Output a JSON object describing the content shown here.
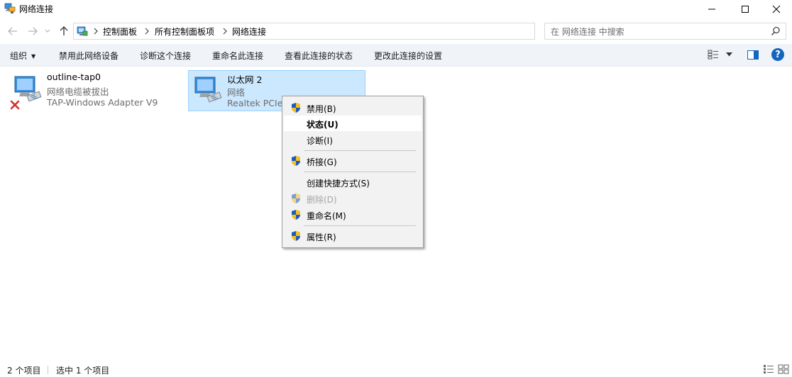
{
  "window": {
    "title": "网络连接",
    "controls": [
      "minimize-icon",
      "maximize-icon",
      "close-icon"
    ]
  },
  "address_bar": {
    "breadcrumbs": [
      "控制面板",
      "所有控制面板项",
      "网络连接"
    ],
    "search_placeholder": "在 网络连接 中搜索"
  },
  "toolbar": {
    "organize_label": "组织",
    "commands": [
      "禁用此网络设备",
      "诊断这个连接",
      "重命名此连接",
      "查看此连接的状态",
      "更改此连接的设置"
    ],
    "help_label": "?"
  },
  "items": [
    {
      "name": "outline-tap0",
      "status": "网络电缆被拔出",
      "device": "TAP-Windows Adapter V9",
      "selected": false,
      "disconnected": true
    },
    {
      "name": "以太网 2",
      "status": "网络",
      "device": "Realtek PCIe",
      "selected": true,
      "disconnected": false
    }
  ],
  "context_menu": {
    "items": [
      {
        "label": "禁用(B)",
        "shield": true,
        "bold": false,
        "disabled": false,
        "highlighted": false
      },
      {
        "label": "状态(U)",
        "shield": false,
        "bold": true,
        "disabled": false,
        "highlighted": true
      },
      {
        "label": "诊断(I)",
        "shield": false,
        "bold": false,
        "disabled": false,
        "highlighted": false
      },
      {
        "label": "桥接(G)",
        "shield": true,
        "bold": false,
        "disabled": false,
        "highlighted": false
      },
      {
        "label": "创建快捷方式(S)",
        "shield": false,
        "bold": false,
        "disabled": false,
        "highlighted": false
      },
      {
        "label": "删除(D)",
        "shield": true,
        "bold": false,
        "disabled": true,
        "highlighted": false
      },
      {
        "label": "重命名(M)",
        "shield": true,
        "bold": false,
        "disabled": false,
        "highlighted": false
      },
      {
        "label": "属性(R)",
        "shield": true,
        "bold": false,
        "disabled": false,
        "highlighted": false
      }
    ]
  },
  "status_bar": {
    "item_count": "2 个项目",
    "selected_count": "选中 1 个项目"
  },
  "colors": {
    "selection_bg": "#cce8ff",
    "selection_border": "#99d1ff",
    "command_bar_bg": "#f0f4f9",
    "help_blue": "#1565c0",
    "disconnected_red": "#d32f2f"
  }
}
